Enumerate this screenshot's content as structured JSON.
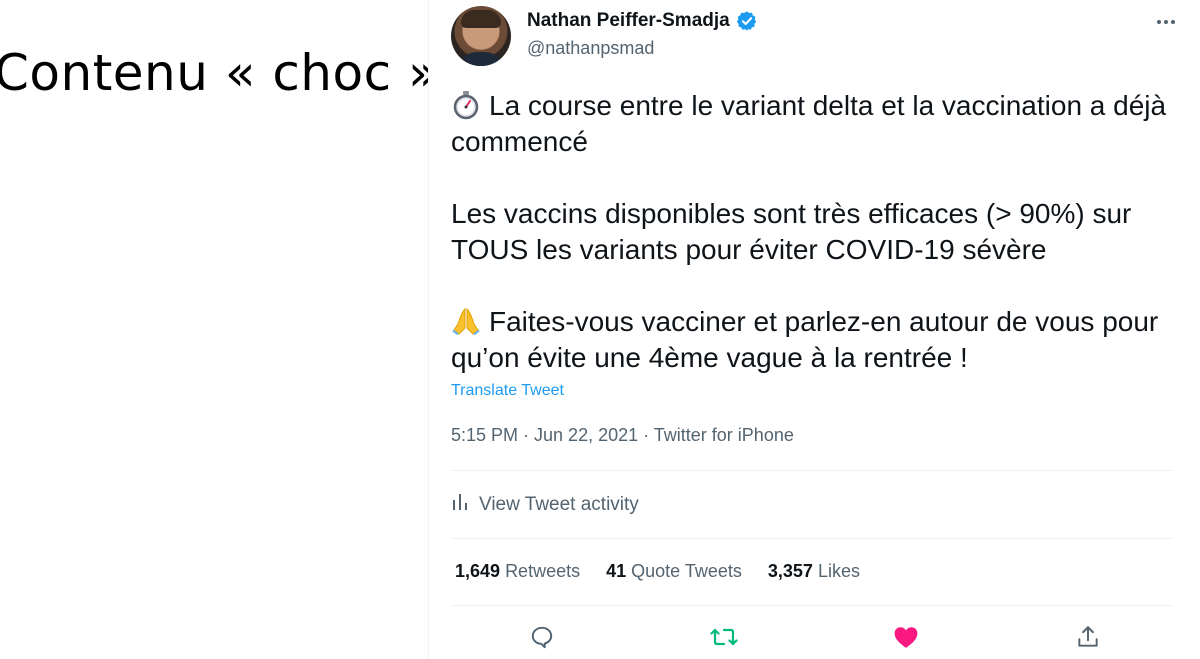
{
  "slide": {
    "title": "Contenu « choc »"
  },
  "tweet": {
    "author": {
      "display_name": "Nathan Peiffer-Smadja",
      "handle": "@nathanpsmad",
      "verified": true
    },
    "paragraphs": [
      {
        "emoji": "stopwatch",
        "text": "La course entre le variant delta et la vaccination a déjà commencé"
      },
      {
        "emoji": "",
        "text": "Les vaccins disponibles sont très efficaces (> 90%) sur TOUS les variants pour éviter COVID-19 sévère"
      },
      {
        "emoji": "folded-hands",
        "text": "Faites-vous vacciner et parlez-en autour de vous pour qu’on évite une 4ème vague à la rentrée !"
      }
    ],
    "translate_label": "Translate Tweet",
    "meta": "5:15 PM · Jun 22, 2021 · Twitter for iPhone",
    "activity_label": "View Tweet activity",
    "stats": {
      "retweets": {
        "count": "1,649",
        "label": "Retweets"
      },
      "quotes": {
        "count": "41",
        "label": "Quote Tweets"
      },
      "likes": {
        "count": "3,357",
        "label": "Likes"
      }
    },
    "colors": {
      "accent": "#1d9bf0",
      "retweet": "#00ba7c",
      "like": "#f91880",
      "muted": "#536471"
    },
    "icons": [
      "reply-icon",
      "retweet-icon",
      "like-icon",
      "share-icon",
      "more-icon",
      "verified-icon",
      "activity-icon"
    ]
  }
}
